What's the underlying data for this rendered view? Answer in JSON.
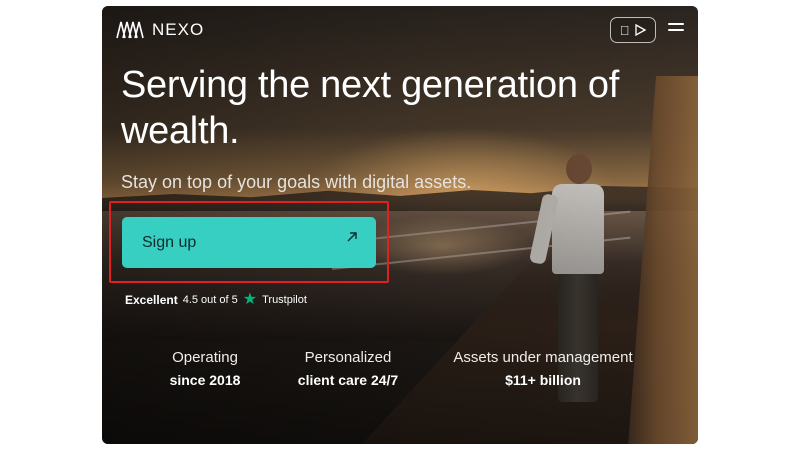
{
  "header": {
    "logo_text": "NEXO",
    "menu_icon": "hamburger-menu-icon",
    "app_icons": [
      "apple-icon",
      "google-play-icon"
    ]
  },
  "hero": {
    "headline": "Serving the next generation of wealth.",
    "subhead": "Stay on top of your goals with digital assets.",
    "cta_label": "Sign up"
  },
  "rating": {
    "label": "Excellent",
    "score": "4.5 out of 5",
    "provider": "Trustpilot"
  },
  "stats": [
    {
      "label": "Operating",
      "value": "since 2018"
    },
    {
      "label": "Personalized",
      "value": "client care 24/7"
    },
    {
      "label": "Assets under management",
      "value": "$11+ billion"
    }
  ],
  "colors": {
    "cta": "#38cfc3",
    "highlight": "#e0211f",
    "trustpilot": "#00b67a"
  }
}
